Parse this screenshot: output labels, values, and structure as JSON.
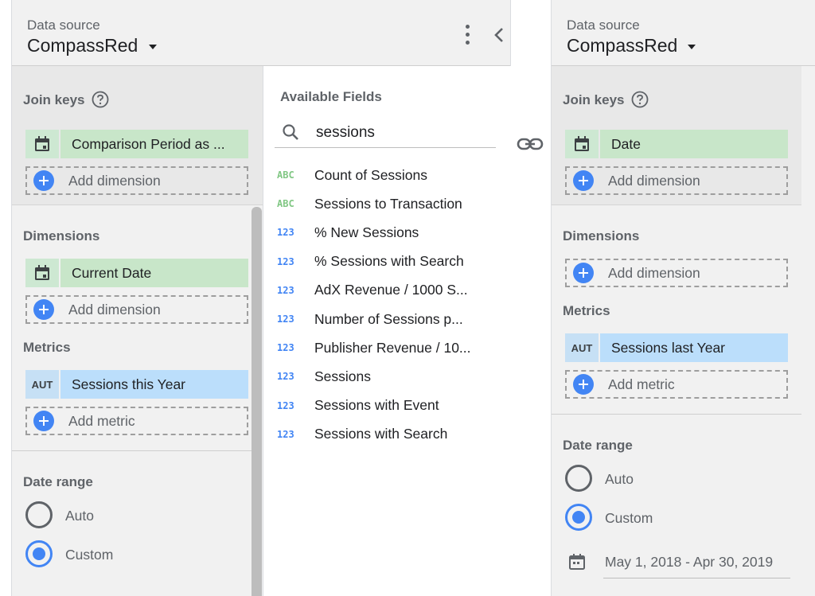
{
  "left_panel": {
    "data_source": {
      "caption": "Data source",
      "name": "CompassRed"
    },
    "join_keys": {
      "title": "Join keys",
      "chip": {
        "type": "calendar-icon",
        "label": "Comparison Period as ..."
      },
      "add_label": "Add dimension"
    },
    "dimensions": {
      "title": "Dimensions",
      "chip": {
        "type": "calendar-icon",
        "label": "Current Date"
      },
      "add_label": "Add dimension"
    },
    "metrics": {
      "title": "Metrics",
      "chip": {
        "type": "AUT",
        "label": "Sessions this Year"
      },
      "add_label": "Add metric"
    },
    "date_range": {
      "title": "Date range",
      "options": [
        {
          "label": "Auto",
          "checked": false
        },
        {
          "label": "Custom",
          "checked": true
        }
      ]
    }
  },
  "available_fields": {
    "title": "Available Fields",
    "search": {
      "value": "sessions",
      "placeholder": ""
    },
    "items": [
      {
        "type": "ABC",
        "kind": "text",
        "label": "Count of Sessions"
      },
      {
        "type": "ABC",
        "kind": "text",
        "label": "Sessions to Transaction"
      },
      {
        "type": "123",
        "kind": "num",
        "label": "% New Sessions"
      },
      {
        "type": "123",
        "kind": "num",
        "label": "% Sessions with Search"
      },
      {
        "type": "123",
        "kind": "num",
        "label": "AdX Revenue / 1000 S..."
      },
      {
        "type": "123",
        "kind": "num",
        "label": "Number of Sessions p..."
      },
      {
        "type": "123",
        "kind": "num",
        "label": "Publisher Revenue / 10..."
      },
      {
        "type": "123",
        "kind": "num",
        "label": "Sessions"
      },
      {
        "type": "123",
        "kind": "num",
        "label": "Sessions with Event"
      },
      {
        "type": "123",
        "kind": "num",
        "label": "Sessions with Search"
      }
    ]
  },
  "right_panel": {
    "data_source": {
      "caption": "Data source",
      "name": "CompassRed"
    },
    "join_keys": {
      "title": "Join keys",
      "chip": {
        "type": "calendar-icon",
        "label": "Date"
      },
      "add_label": "Add dimension"
    },
    "dimensions": {
      "title": "Dimensions",
      "add_label": "Add dimension"
    },
    "metrics": {
      "title": "Metrics",
      "chip": {
        "type": "AUT",
        "label": "Sessions last Year"
      },
      "add_label": "Add metric"
    },
    "date_range": {
      "title": "Date range",
      "options": [
        {
          "label": "Auto",
          "checked": false
        },
        {
          "label": "Custom",
          "checked": true
        }
      ],
      "value": "May 1, 2018 - Apr 30, 2019"
    }
  },
  "colors": {
    "accent": "#4285f4",
    "dimension_chip": "#c8e6c9",
    "metric_chip": "#bbdefb",
    "panel_bg": "#f1f1f1"
  }
}
